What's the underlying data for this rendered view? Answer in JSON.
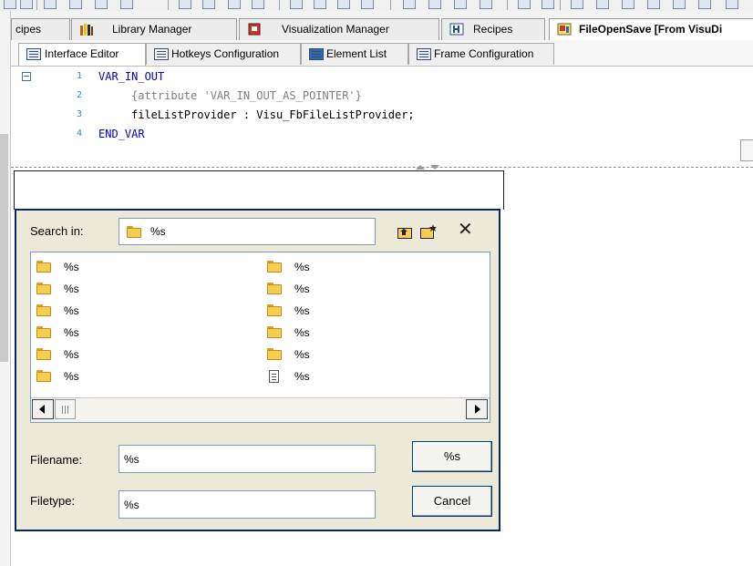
{
  "tabs": [
    {
      "label": "cipes"
    },
    {
      "label": "Library Manager"
    },
    {
      "label": "Visualization Manager"
    },
    {
      "label": "Recipes"
    },
    {
      "label": "FileOpenSave [From VisuDi"
    }
  ],
  "subtabs": [
    {
      "label": "Interface Editor"
    },
    {
      "label": "Hotkeys Configuration"
    },
    {
      "label": "Element List"
    },
    {
      "label": "Frame Configuration"
    }
  ],
  "code": {
    "lines": [
      {
        "num": "1",
        "text": "VAR_IN_OUT"
      },
      {
        "num": "2",
        "text": "{attribute 'VAR_IN_OUT_AS_POINTER'}"
      },
      {
        "num": "3",
        "text": "fileListProvider : Visu_FbFileListProvider;"
      },
      {
        "num": "4",
        "text": "END_VAR"
      }
    ]
  },
  "dialog": {
    "search_in_label": "Search in:",
    "search_in_value": "%s",
    "files_left": [
      "%s",
      "%s",
      "%s",
      "%s",
      "%s",
      "%s"
    ],
    "files_right": [
      "%s",
      "%s",
      "%s",
      "%s",
      "%s",
      "%s"
    ],
    "filename_label": "Filename:",
    "filename_value": "%s",
    "filetype_label": "Filetype:",
    "filetype_value": "%s",
    "ok_label": "%s",
    "cancel_label": "Cancel"
  },
  "colors": {
    "dialog_border": "#0a246a",
    "dialog_background": "#ece9d8",
    "keyword": "#0000cc",
    "comment": "#7f7f7f",
    "line_number": "#2b8fb8"
  }
}
